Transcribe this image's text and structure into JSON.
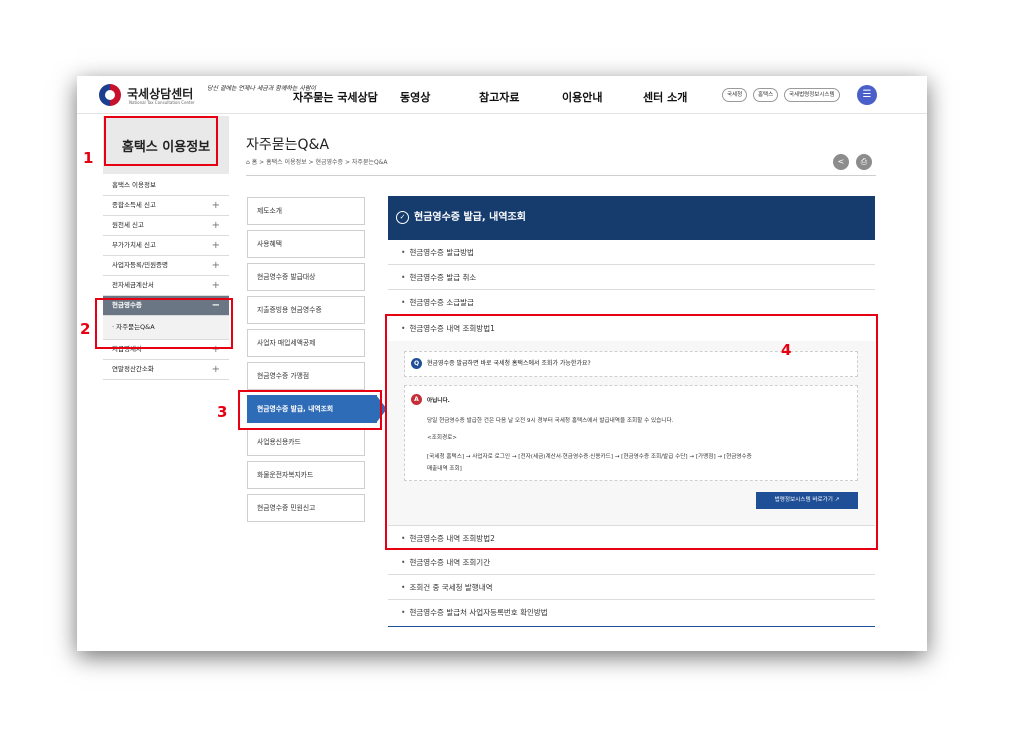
{
  "header": {
    "logo_title": "국세상담센터",
    "logo_subtitle": "National Tax Consultation Center",
    "logo_script": "당신 곁에는 언제나 세금과 함께하는 사람이",
    "nav": [
      "자주묻는 국세상담",
      "동영상",
      "참고자료",
      "이용안내",
      "센터 소개"
    ],
    "pills": [
      "국세청",
      "홈택스",
      "국세법령정보시스템"
    ],
    "menu_icon": "hamburger-icon"
  },
  "sidebar": {
    "title": "홈택스 이용정보",
    "items": [
      {
        "label": "홈택스 이용정보",
        "expand": ""
      },
      {
        "label": "종합소득세 신고",
        "expand": "+"
      },
      {
        "label": "원천세 신고",
        "expand": "+"
      },
      {
        "label": "부가가치세 신고",
        "expand": "+"
      },
      {
        "label": "사업자등록/민원증명",
        "expand": "+"
      },
      {
        "label": "전자세금계산서",
        "expand": "+"
      },
      {
        "label": "현금영수증",
        "expand": "−"
      },
      {
        "label": "· 자주묻는Q&A",
        "expand": ""
      },
      {
        "label": "지급명세서",
        "expand": "+"
      },
      {
        "label": "연말정산간소화",
        "expand": "+"
      }
    ]
  },
  "main": {
    "title": "자주묻는Q&A",
    "breadcrumb": "⌂ 홈  >  홈택스 이용정보  >  현금영수증  >  자주묻는Q&A",
    "share_icon": "share-icon",
    "print_icon": "print-icon",
    "tabs": [
      "제도소개",
      "사용혜택",
      "현금영수증 발급대상",
      "지출증빙용 현금영수증",
      "사업자 매입세액공제",
      "현금영수증 가맹점",
      "현금영수증 발급, 내역조회",
      "사업용신용카드",
      "화물운전자복지카드",
      "현금영수증 민원신고"
    ],
    "content_title": "현금영수증 발급, 내역조회",
    "faq": [
      "현금영수증 발급방법",
      "현금영수증 발급 취소",
      "현금영수증 소급발급",
      "현금영수증 내역 조회방법1",
      "현금영수증 내역 조회방법2",
      "현금영수증 내역 조회기간",
      "조회건 중 국세청 발행내역",
      "현금영수증 발급처 사업자등록번호 확인방법"
    ],
    "qa": {
      "q_badge": "Q",
      "question": "현금영수증 발급하면 바로 국세청 홈택스에서 조회가 가능한가요?",
      "a_badge": "A",
      "answer_title": "아닙니다.",
      "answer_line1": "당일 현금영수증 발급한 건은 다음 날 오전 9시 경부터 국세청 홈택스에서 발급내역을 조회할 수 있습니다.",
      "answer_line2": "<조회경로>",
      "answer_line3": "[국세청 홈택스] → 사업자로 로그인 → [전자(세금)계산서·현금영수증·신용카드] → [현금영수증 조회/발급 수단] → [가맹점] → [현금영수증",
      "answer_line4": "매출내역 조회]",
      "link_button": "법령정보시스템 바로가기 ↗"
    }
  },
  "annotations": [
    "1",
    "2",
    "3",
    "4"
  ],
  "colors": {
    "accent_navy": "#163c6e",
    "tab_blue": "#2f6cb7",
    "annotation_red": "#e60012"
  }
}
